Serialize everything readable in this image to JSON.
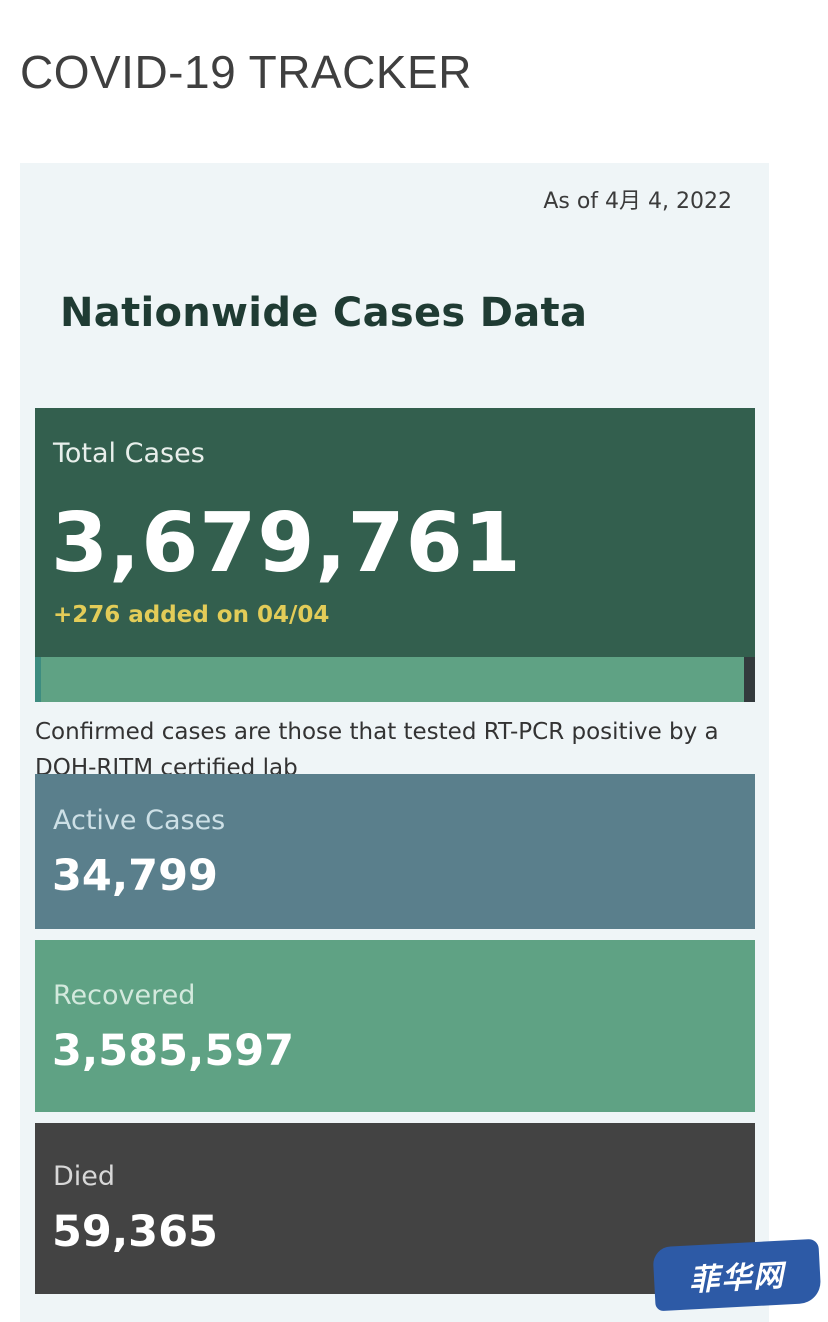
{
  "page": {
    "title": "COVID-19 TRACKER"
  },
  "dashboard": {
    "as_of": "As of 4月 4, 2022",
    "heading": "Nationwide Cases Data",
    "total": {
      "label": "Total Cases",
      "value": "3,679,761",
      "added": "+276 added on 04/04"
    },
    "note": "Confirmed cases are those that tested RT-PCR positive by a DOH-RITM certified lab",
    "active": {
      "label": "Active Cases",
      "value": "34,799"
    },
    "recovered": {
      "label": "Recovered",
      "value": "3,585,597"
    },
    "died": {
      "label": "Died",
      "value": "59,365"
    }
  },
  "watermark": {
    "text": "菲华网"
  },
  "colors": {
    "total_card": "#335f4e",
    "active_card": "#5a7f8c",
    "recovered_card": "#5fa284",
    "died_card": "#434343",
    "added_text": "#e3cc58"
  }
}
